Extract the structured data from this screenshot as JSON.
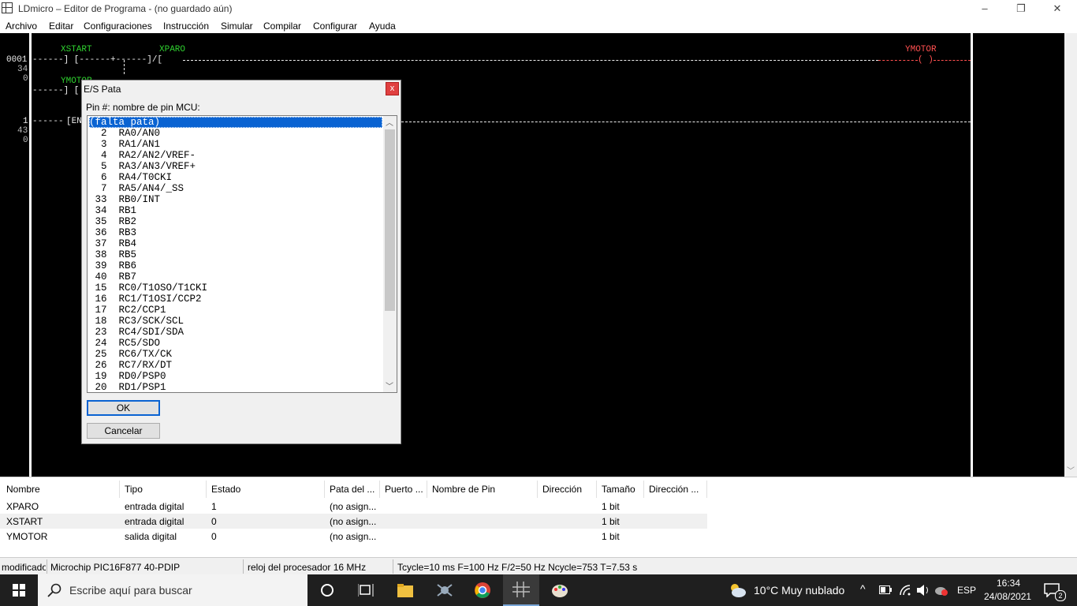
{
  "window": {
    "title": "LDmicro – Editor de Programa - (no guardado aún)",
    "minimize": "–",
    "maximize": "❐",
    "close": "✕"
  },
  "menu": [
    "Archivo",
    "Editar",
    "Configuraciones",
    "Instrucción",
    "Simular",
    "Compilar",
    "Configurar",
    "Ayuda"
  ],
  "ladder": {
    "rung1_num": "0001",
    "rung1_sub1": "34",
    "rung1_sub2": "0",
    "rung2_num": "1",
    "rung2_sub1": "43",
    "rung2_sub2": "0",
    "xstart": "XSTART",
    "xparo": "XPARO",
    "ymotor": "YMOTOR",
    "ymotor2": "YMOTOR",
    "end_label": "[EN",
    "coil": "( )"
  },
  "dialog": {
    "title": "E/S Pata",
    "close": "x",
    "label": "Pin #:   nombre de pin MCU:",
    "pins": [
      "(falta pata)",
      "  2  RA0/AN0",
      "  3  RA1/AN1",
      "  4  RA2/AN2/VREF-",
      "  5  RA3/AN3/VREF+",
      "  6  RA4/T0CKI",
      "  7  RA5/AN4/_SS",
      " 33  RB0/INT",
      " 34  RB1",
      " 35  RB2",
      " 36  RB3",
      " 37  RB4",
      " 38  RB5",
      " 39  RB6",
      " 40  RB7",
      " 15  RC0/T1OSO/T1CKI",
      " 16  RC1/T1OSI/CCP2",
      " 17  RC2/CCP1",
      " 18  RC3/SCK/SCL",
      " 23  RC4/SDI/SDA",
      " 24  RC5/SDO",
      " 25  RC6/TX/CK",
      " 26  RC7/RX/DT",
      " 19  RD0/PSP0",
      " 20  RD1/PSP1"
    ],
    "ok": "OK",
    "cancel": "Cancelar"
  },
  "table": {
    "headers": [
      "Nombre",
      "Tipo",
      "Estado",
      "Pata del ...",
      "Puerto ...",
      "Nombre de Pin",
      "Dirección",
      "Tamaño",
      "Dirección ..."
    ],
    "rows": [
      [
        "XPARO",
        "entrada digital",
        "1",
        "(no asign...",
        "1 bit"
      ],
      [
        "XSTART",
        "entrada digital",
        "0",
        "(no asign...",
        "1 bit"
      ],
      [
        "YMOTOR",
        "salida digital",
        "0",
        "(no asign...",
        "1 bit"
      ]
    ]
  },
  "status": {
    "mode": "modificado",
    "mcu": "Microchip PIC16F877 40-PDIP",
    "clock": "reloj del procesador 16 MHz",
    "cycle": "Tcycle=10 ms F=100 Hz F/2=50 Hz Ncycle=753 T=7.53 s"
  },
  "taskbar": {
    "search_placeholder": "Escribe aquí para buscar",
    "weather": "10°C  Muy nublado",
    "lang": "ESP",
    "time": "16:34",
    "date": "24/08/2021",
    "notif_count": "2"
  },
  "colors": {
    "ladder_bg": "#000000",
    "contact_label": "#2fd12f",
    "coil_label": "#ff5050",
    "selection": "#0a63d2",
    "taskbar": "#1f1f1f"
  }
}
